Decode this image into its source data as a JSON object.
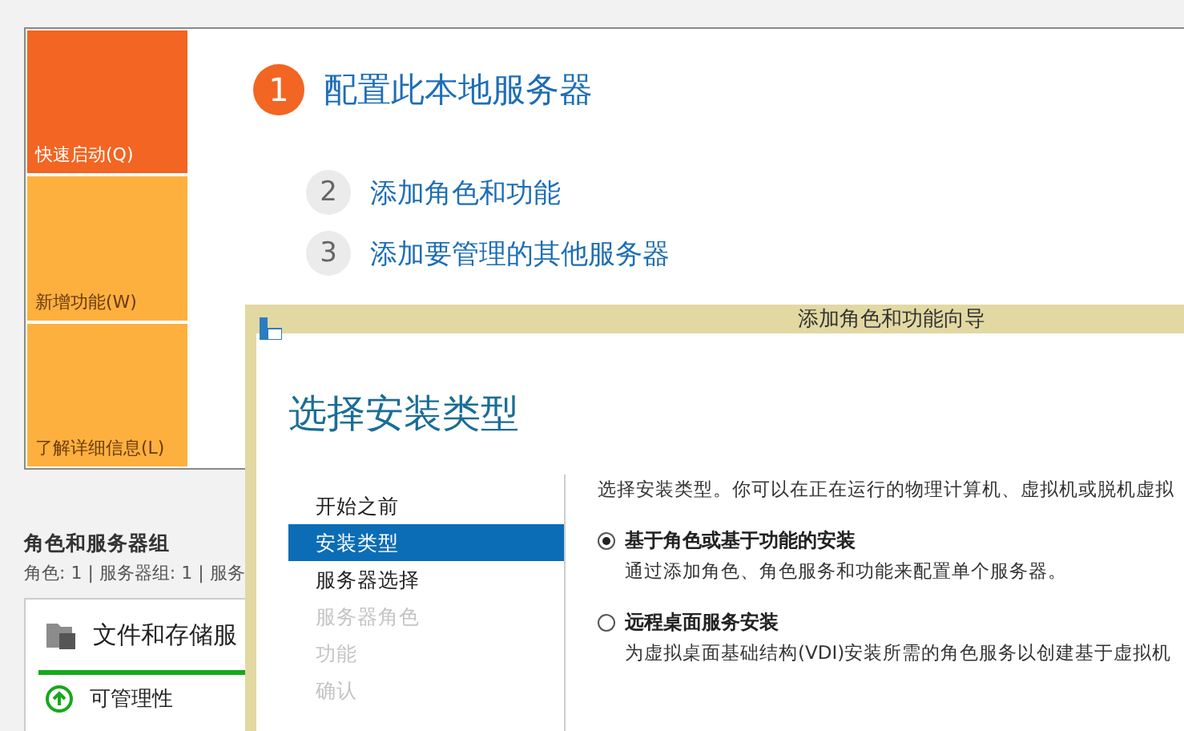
{
  "tiles": [
    {
      "label": "快速启动(Q)",
      "selected": true
    },
    {
      "label": "新增功能(W)",
      "selected": false
    },
    {
      "label": "了解详细信息(L)",
      "selected": false
    }
  ],
  "steps": [
    {
      "number": "1",
      "label": "配置此本地服务器",
      "selected": true
    },
    {
      "number": "2",
      "label": "添加角色和功能",
      "selected": false
    },
    {
      "number": "3",
      "label": "添加要管理的其他服务器",
      "selected": false
    }
  ],
  "roles_section": {
    "title": "角色和服务器组",
    "summary": "角色: 1 | 服务器组: 1 | 服务",
    "card": {
      "name": "文件和存储服",
      "status": "可管理性"
    }
  },
  "dialog": {
    "title": "添加角色和功能向导",
    "heading": "选择安装类型",
    "nav": [
      {
        "label": "开始之前",
        "selected": false,
        "disabled": false
      },
      {
        "label": "安装类型",
        "selected": true,
        "disabled": false
      },
      {
        "label": "服务器选择",
        "selected": false,
        "disabled": false
      },
      {
        "label": "服务器角色",
        "selected": false,
        "disabled": true
      },
      {
        "label": "功能",
        "selected": false,
        "disabled": true
      },
      {
        "label": "确认",
        "selected": false,
        "disabled": true
      }
    ],
    "intro": "选择安装类型。你可以在正在运行的物理计算机、虚拟机或脱机虚拟",
    "options": [
      {
        "label": "基于角色或基于功能的安装",
        "description": "通过添加角色、角色服务和功能来配置单个服务器。",
        "selected": true
      },
      {
        "label": "远程桌面服务安装",
        "description": "为虚拟桌面基础结构(VDI)安装所需的角色服务以创建基于虚拟机",
        "selected": false
      }
    ]
  }
}
